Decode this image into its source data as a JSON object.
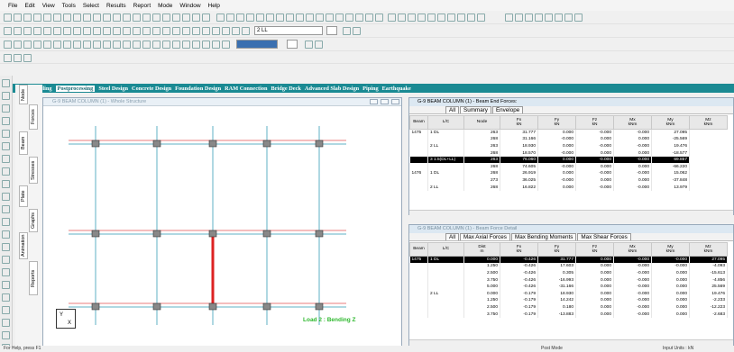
{
  "menu": [
    "File",
    "Edit",
    "View",
    "Tools",
    "Select",
    "Results",
    "Report",
    "Mode",
    "Window",
    "Help"
  ],
  "toolbar": {
    "load_combo": "2 LL",
    "load_combo2": ""
  },
  "side_tabs": [
    "Node",
    "Forces",
    "Beam",
    "Stresses",
    "Plate",
    "Graphs",
    "Animation",
    "Reports"
  ],
  "ribbon": {
    "tabs": [
      "Modeling",
      "Postprocessing",
      "Steel Design",
      "Concrete Design",
      "Foundation Design",
      "RAM Connection",
      "Bridge Deck",
      "Advanced Slab Design",
      "Piping",
      "Earthquake"
    ],
    "active": 1
  },
  "view": {
    "title": "G-9 BEAM COLUMN (1) - Whole Structure",
    "load_label": "Load 2 : Bending Z",
    "axis_y": "Y",
    "axis_x": "X"
  },
  "end_forces": {
    "title": "G-9 BEAM COLUMN (1) - Beam End Forces:",
    "tabs": [
      "All",
      "Summary",
      "Envelope"
    ],
    "columns": [
      [
        "Beam",
        ""
      ],
      [
        "L/C",
        ""
      ],
      [
        "Node",
        ""
      ],
      [
        "Fx",
        "kN"
      ],
      [
        "Fy",
        "kN"
      ],
      [
        "Fz",
        "kN"
      ],
      [
        "Mx",
        "kNm"
      ],
      [
        "My",
        "kNm"
      ],
      [
        "Mz",
        "kNm"
      ]
    ],
    "rows": [
      [
        "1475",
        "1 DL",
        "263",
        "31.777",
        "0.000",
        "-0.000",
        "-0.000",
        "27.095"
      ],
      [
        "",
        "",
        "268",
        "31.166",
        "-0.000",
        "0.000",
        "0.000",
        "-25.569"
      ],
      [
        "",
        "2 LL",
        "263",
        "18.930",
        "0.000",
        "-0.000",
        "-0.000",
        "19.476"
      ],
      [
        "",
        "",
        "268",
        "18.570",
        "-0.000",
        "0.000",
        "0.000",
        "-18.577"
      ],
      [
        "",
        "3 1.5(DL+LL)",
        "263",
        "76.060",
        "0.000",
        "-0.000",
        "-0.000",
        "69.857"
      ],
      [
        "",
        "",
        "268",
        "74.605",
        "-0.000",
        "0.000",
        "0.000",
        "-66.220"
      ],
      [
        "1476",
        "1 DL",
        "268",
        "26.919",
        "0.000",
        "-0.000",
        "-0.000",
        "15.062"
      ],
      [
        "",
        "",
        "273",
        "36.025",
        "-0.000",
        "0.000",
        "0.000",
        "-37.848"
      ],
      [
        "",
        "2 LL",
        "268",
        "16.822",
        "0.000",
        "-0.000",
        "-0.000",
        "13.979"
      ]
    ],
    "selected_row": 4
  },
  "force_detail": {
    "title": "G-9 BEAM COLUMN (1) - Beam Force Detail",
    "tabs": [
      "All",
      "Max Axial Forces",
      "Max Bending Moments",
      "Max Shear Forces"
    ],
    "columns": [
      [
        "Beam",
        ""
      ],
      [
        "L/C",
        ""
      ],
      [
        "Dist",
        "m"
      ],
      [
        "Fx",
        "kN"
      ],
      [
        "Fy",
        "kN"
      ],
      [
        "Fz",
        "kN"
      ],
      [
        "Mx",
        "kNm"
      ],
      [
        "My",
        "kNm"
      ],
      [
        "Mz",
        "kNm"
      ]
    ],
    "rows": [
      [
        "1475",
        "1 DL",
        "0.000",
        "-0.426",
        "31.777",
        "0.000",
        "-0.000",
        "-0.000",
        "27.095"
      ],
      [
        "",
        "",
        "1.250",
        "-0.426",
        "17.603",
        "0.000",
        "-0.000",
        "-0.000",
        "-4.093"
      ],
      [
        "",
        "",
        "2.500",
        "-0.426",
        "0.305",
        "0.000",
        "-0.000",
        "0.000",
        "-15.613"
      ],
      [
        "",
        "",
        "3.750",
        "-0.426",
        "-16.993",
        "0.000",
        "-0.000",
        "0.000",
        "-4.856"
      ],
      [
        "",
        "",
        "5.000",
        "-0.426",
        "-31.166",
        "0.000",
        "-0.000",
        "0.000",
        "25.569"
      ],
      [
        "",
        "2 LL",
        "0.000",
        "-0.179",
        "18.930",
        "0.000",
        "-0.000",
        "0.000",
        "19.476"
      ],
      [
        "",
        "",
        "1.250",
        "-0.179",
        "14.242",
        "0.000",
        "-0.000",
        "0.000",
        "-2.233"
      ],
      [
        "",
        "",
        "2.500",
        "-0.179",
        "0.180",
        "0.000",
        "-0.000",
        "0.000",
        "-12.223"
      ],
      [
        "",
        "",
        "3.750",
        "-0.179",
        "-13.883",
        "0.000",
        "-0.000",
        "0.000",
        "-2.683"
      ]
    ],
    "selected_row": 0
  },
  "status": {
    "left": "For Help, press F1",
    "mid": "Post Mode",
    "right": "Input Units : kN"
  }
}
